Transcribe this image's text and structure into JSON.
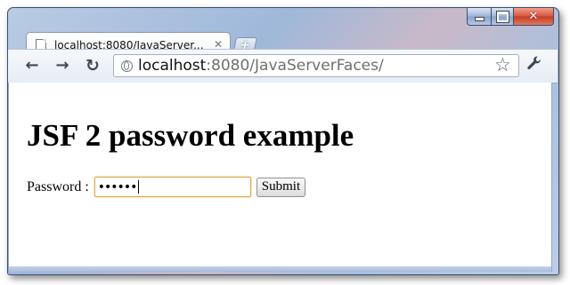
{
  "window": {
    "caption": {
      "minimize": "_",
      "maximize": "□",
      "close": "✕"
    }
  },
  "tab": {
    "title": "localhost:8080/JavaServer...",
    "close": "✕"
  },
  "new_tab": "+",
  "toolbar": {
    "back": "←",
    "forward": "→",
    "reload": "↻",
    "url_host": "localhost",
    "url_rest": ":8080/JavaServerFaces/",
    "bookmark": "☆",
    "menu": "🔧"
  },
  "page": {
    "heading": "JSF 2 password example",
    "password_label": "Password :",
    "password_value": "••••••",
    "submit_label": "Submit"
  },
  "colors": {
    "input_focus_border": "#e1a44f",
    "frame": "#a9c0e0"
  }
}
